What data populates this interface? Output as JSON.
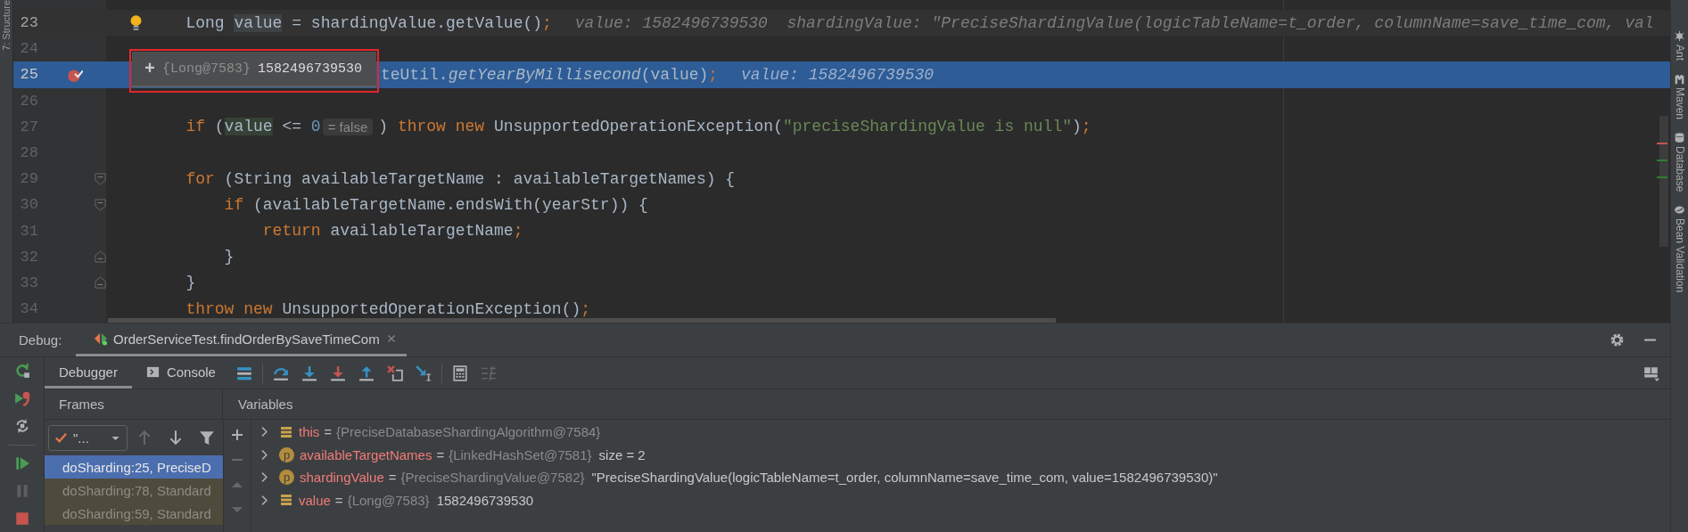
{
  "left_strip": {
    "tabs": [
      {
        "label": "7: Structure"
      }
    ]
  },
  "editor": {
    "lines": [
      {
        "number": "23",
        "caret_line": true,
        "execution": false,
        "gutter": {
          "kind": "bulb"
        },
        "segments": [
          {
            "kind": "code",
            "tokens": [
              {
                "kind": "plain",
                "text": "Long "
              },
              {
                "kind": "usage_write",
                "text": "value"
              },
              {
                "kind": "plain",
                "text": " = shardingValue.getValue()"
              },
              {
                "kind": "punct",
                "text": ";"
              }
            ]
          },
          {
            "kind": "inline_value",
            "text": "value: 1582496739530  shardingValue: \"PreciseShardingValue(logicTableName=t_order, columnName=save_time_com, val"
          }
        ]
      },
      {
        "number": "24",
        "caret_line": false,
        "execution": false
      },
      {
        "number": "25",
        "caret_line": false,
        "execution": true,
        "gutter": {
          "kind": "breakpoint"
        },
        "tooltip": {
          "expand": "+",
          "type": "{Long@7583}",
          "value": "1582496739530",
          "annotated": true
        },
        "segments": [
          {
            "kind": "code",
            "tokens": [
              {
                "kind": "plain",
                "text": "teUtil."
              },
              {
                "kind": "call",
                "text": "getYearByMillisecond"
              },
              {
                "kind": "plain",
                "text": "(value)"
              },
              {
                "kind": "punct",
                "text": ";"
              }
            ]
          },
          {
            "kind": "inline_value",
            "text": "value: 1582496739530"
          }
        ]
      },
      {
        "number": "26",
        "caret_line": false,
        "execution": false
      },
      {
        "number": "27",
        "caret_line": false,
        "execution": false,
        "segments": [
          {
            "kind": "code",
            "tokens": [
              {
                "kind": "kw",
                "text": "if"
              },
              {
                "kind": "plain",
                "text": " ("
              },
              {
                "kind": "usage_read",
                "text": "value"
              },
              {
                "kind": "plain",
                "text": " <= "
              },
              {
                "kind": "num",
                "text": "0"
              }
            ]
          },
          {
            "kind": "hint",
            "text": "= false"
          },
          {
            "kind": "code",
            "tokens": [
              {
                "kind": "plain",
                "text": ") "
              },
              {
                "kind": "kw",
                "text": "throw new"
              },
              {
                "kind": "plain",
                "text": " UnsupportedOperationException("
              },
              {
                "kind": "str",
                "text": "\"preciseShardingValue is null\""
              },
              {
                "kind": "plain",
                "text": ")"
              },
              {
                "kind": "punct",
                "text": ";"
              }
            ]
          }
        ]
      },
      {
        "number": "28",
        "caret_line": false,
        "execution": false
      },
      {
        "number": "29",
        "caret_line": false,
        "execution": false,
        "fold": {
          "kind": "start"
        },
        "segments": [
          {
            "kind": "code",
            "tokens": [
              {
                "kind": "kw",
                "text": "for"
              },
              {
                "kind": "plain",
                "text": " (String availableTargetName : availableTargetNames) {"
              }
            ]
          }
        ],
        "children": [
          {
            "number": "30",
            "caret_line": false,
            "execution": false,
            "fold": {
              "kind": "start"
            },
            "segments": [
              {
                "kind": "code",
                "tokens": [
                  {
                    "kind": "kw",
                    "text": "if"
                  },
                  {
                    "kind": "plain",
                    "text": " (availableTargetName.endsWith(yearStr)) {"
                  }
                ]
              }
            ],
            "children": [
              {
                "number": "31",
                "caret_line": false,
                "execution": false,
                "segments": [
                  {
                    "kind": "code",
                    "tokens": [
                      {
                        "kind": "kw",
                        "text": "return"
                      },
                      {
                        "kind": "plain",
                        "text": " availableTargetName"
                      },
                      {
                        "kind": "punct",
                        "text": ";"
                      }
                    ]
                  }
                ]
              }
            ]
          },
          {
            "number": "32",
            "caret_line": false,
            "execution": false,
            "fold": {
              "kind": "end"
            },
            "segments": [
              {
                "kind": "code",
                "tokens": [
                  {
                    "kind": "plain",
                    "text": "}"
                  }
                ]
              }
            ]
          }
        ]
      },
      {
        "number": "33",
        "caret_line": false,
        "execution": false,
        "fold": {
          "kind": "end"
        },
        "segments": [
          {
            "kind": "code",
            "tokens": [
              {
                "kind": "plain",
                "text": "}"
              }
            ]
          }
        ]
      },
      {
        "number": "34",
        "caret_line": false,
        "execution": false,
        "segments": [
          {
            "kind": "code",
            "tokens": [
              {
                "kind": "kw",
                "text": "throw new"
              },
              {
                "kind": "plain",
                "text": " UnsupportedOperationException()"
              },
              {
                "kind": "punct",
                "text": ";"
              }
            ]
          }
        ]
      }
    ],
    "stripe_marks": [
      {
        "color": "#c75450"
      },
      {
        "color": "#2e7d32"
      },
      {
        "color": "#2e7d32"
      }
    ]
  },
  "right_strip": {
    "tabs": [
      {
        "label": "Ant",
        "kind": "ant"
      },
      {
        "label": "Maven",
        "kind": "maven"
      },
      {
        "label": "Database",
        "kind": "database"
      },
      {
        "label": "Bean Validation",
        "kind": "bean"
      }
    ]
  },
  "debug": {
    "title": "Debug:",
    "session_tabs": [
      {
        "label": "OrderServiceTest.findOrderBySaveTimeCom",
        "selected": true
      }
    ],
    "side_actions": [
      {
        "kind": "rerun"
      },
      {
        "kind": "resume_breakpoints"
      },
      {
        "kind": "restore"
      },
      {
        "kind": "separator"
      },
      {
        "kind": "resume"
      },
      {
        "kind": "pause",
        "disabled": true
      },
      {
        "kind": "stop"
      }
    ],
    "tabs": [
      {
        "label": "Debugger",
        "selected": true,
        "kind": "plain"
      },
      {
        "label": "Console",
        "selected": false,
        "kind": "console"
      }
    ],
    "toolbar": [
      {
        "kind": "bars"
      },
      {
        "kind": "separator"
      },
      {
        "kind": "step_over"
      },
      {
        "kind": "step_into"
      },
      {
        "kind": "force_step_into"
      },
      {
        "kind": "step_out"
      },
      {
        "kind": "drop_frame"
      },
      {
        "kind": "run_to_cursor"
      },
      {
        "kind": "separator"
      },
      {
        "kind": "evaluate"
      },
      {
        "kind": "trace",
        "disabled": true
      }
    ],
    "frames": {
      "header": "Frames",
      "thread": {
        "label": "\"..."
      },
      "nav": [
        {
          "kind": "up",
          "disabled": true
        },
        {
          "kind": "down",
          "disabled": false
        },
        {
          "kind": "filter",
          "disabled": false
        }
      ],
      "items": [
        {
          "label": "doSharding:25, PreciseD",
          "selected": true,
          "library": false
        },
        {
          "label": "doSharding:78, Standard",
          "selected": false,
          "library": true
        },
        {
          "label": "doSharding:59, Standard",
          "selected": false,
          "library": true
        }
      ]
    },
    "variables": {
      "header": "Variables",
      "side": [
        {
          "kind": "add",
          "disabled": false
        },
        {
          "kind": "remove",
          "disabled": true
        },
        {
          "kind": "up",
          "disabled": true
        },
        {
          "kind": "down",
          "disabled": true
        }
      ],
      "items": [
        {
          "kind": "field",
          "name": "this",
          "eq": "=",
          "type": "{PreciseDatabaseShardingAlgorithm@7584}",
          "expanded": false
        },
        {
          "kind": "parameter",
          "badge": "p",
          "name": "availableTargetNames",
          "eq": "=",
          "type": "{LinkedHashSet@7581}",
          "value": "size = 2",
          "expanded": false
        },
        {
          "kind": "parameter",
          "badge": "p",
          "name": "shardingValue",
          "eq": "=",
          "type": "{PreciseShardingValue@7582}",
          "value": "\"PreciseShardingValue(logicTableName=t_order, columnName=save_time_com, value=1582496739530)\"",
          "expanded": false
        },
        {
          "kind": "field",
          "name": "value",
          "eq": "=",
          "type": "{Long@7583}",
          "value": "1582496739530",
          "expanded": false
        }
      ]
    }
  }
}
